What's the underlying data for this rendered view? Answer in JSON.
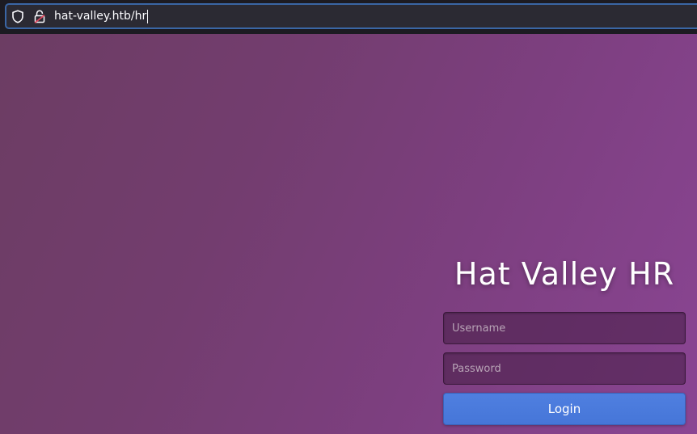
{
  "browser": {
    "url": "hat-valley.htb/hr",
    "icons": [
      "shield-icon",
      "lock-insecure-icon"
    ]
  },
  "login": {
    "title": "Hat Valley HR",
    "username_placeholder": "Username",
    "password_placeholder": "Password",
    "button_label": "Login"
  },
  "colors": {
    "browser_bar": "#1c1b22",
    "url_field": "#2b2a33",
    "url_focus_border": "#3a66a5",
    "background_start": "#6c3d63",
    "background_end": "#8a4593",
    "button": "#4a79dc",
    "insecure_lock": "#e0475d"
  }
}
